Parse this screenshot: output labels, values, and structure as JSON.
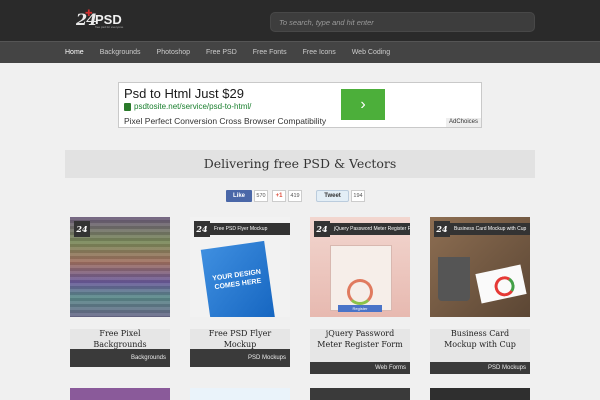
{
  "header": {
    "logo_num": "24",
    "logo_text": "PSD",
    "logo_tagline": "free psd for everyone",
    "search_placeholder": "To search, type and hit enter"
  },
  "nav": {
    "items": [
      "Home",
      "Backgrounds",
      "Photoshop",
      "Free PSD",
      "Free Fonts",
      "Free Icons",
      "Web Coding"
    ],
    "active_index": 0
  },
  "ad": {
    "headline": "Psd to Html Just $29",
    "url": "psdtosite.net/service/psd-to-html/",
    "description": "Pixel Perfect Conversion Cross Browser Compatibility",
    "cta_icon": "chevron-right-icon",
    "adchoices": "AdChoices"
  },
  "title_bar": "Delivering free PSD & Vectors",
  "social": {
    "fb_label": "Like",
    "fb_count": "570",
    "gplus_label": "+1",
    "gplus_count": "419",
    "tw_label": "Tweet",
    "tw_count": "194"
  },
  "cards": [
    {
      "title": "Free Pixel Backgrounds",
      "category": "Backgrounds",
      "strip": "",
      "badge": "24"
    },
    {
      "title": "Free PSD Flyer Mockup",
      "category": "PSD Mockups",
      "strip": "Free PSD Flyer Mockup",
      "badge": "24",
      "flyer_text": "YOUR DESIGN COMES HERE"
    },
    {
      "title": "jQuery Password Meter Register Form",
      "category": "Web Forms",
      "strip": "jQuery Password Meter Register Form",
      "badge": "24",
      "submit": "Register"
    },
    {
      "title": "Business Card Mockup with Cup",
      "category": "PSD Mockups",
      "strip": "Business Card Mockup with Cup",
      "badge": "24"
    }
  ],
  "colors": {
    "header_bg": "#2a2a2a",
    "nav_bg": "#444444",
    "page_bg": "#f0f0f0",
    "ad_url": "#1a7f2e",
    "ad_cta": "#4caf3a",
    "fb": "#4a67a8",
    "gplus": "#dd4b39"
  }
}
